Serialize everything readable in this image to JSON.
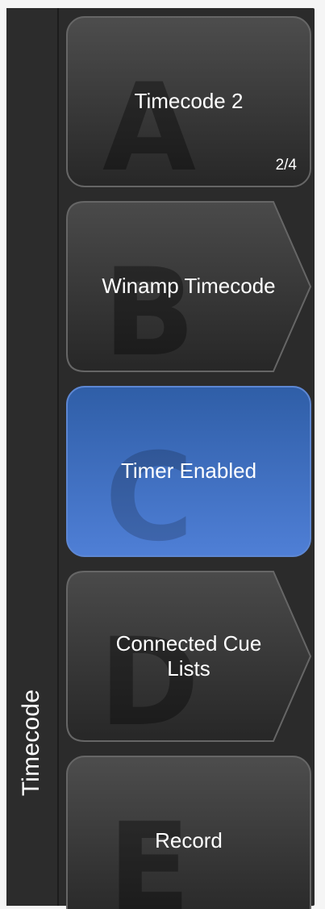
{
  "sidebar": {
    "label": "Timecode"
  },
  "keys": {
    "a": {
      "letter": "A",
      "label": "Timecode 2",
      "page": "2/4",
      "style": "rounded-rect",
      "fill_top": "#4d4d4d",
      "fill_bottom": "#272727",
      "stroke": "#666666"
    },
    "b": {
      "letter": "B",
      "label": "Winamp Timecode",
      "style": "arrow",
      "fill_top": "#4a4a4a",
      "fill_bottom": "#272727",
      "stroke": "#666666"
    },
    "c": {
      "letter": "C",
      "label": "Timer Enabled",
      "style": "rounded-rect-active",
      "fill_top": "#2f5ea7",
      "fill_bottom": "#4f7fd6",
      "stroke": "#5d87d3"
    },
    "d": {
      "letter": "D",
      "label": "Connected Cue Lists",
      "style": "arrow",
      "fill_top": "#4a4a4a",
      "fill_bottom": "#272727",
      "stroke": "#666666"
    },
    "e": {
      "letter": "E",
      "label": "Record",
      "style": "rounded-rect",
      "fill_top": "#4d4d4d",
      "fill_bottom": "#272727",
      "stroke": "#666666"
    }
  },
  "colors": {
    "panel": "#2b2b2b",
    "sidebar": "#2c2c2c",
    "text": "#ffffff",
    "frame": "#f5f5f5",
    "active_blue": "#3f6fc3"
  }
}
